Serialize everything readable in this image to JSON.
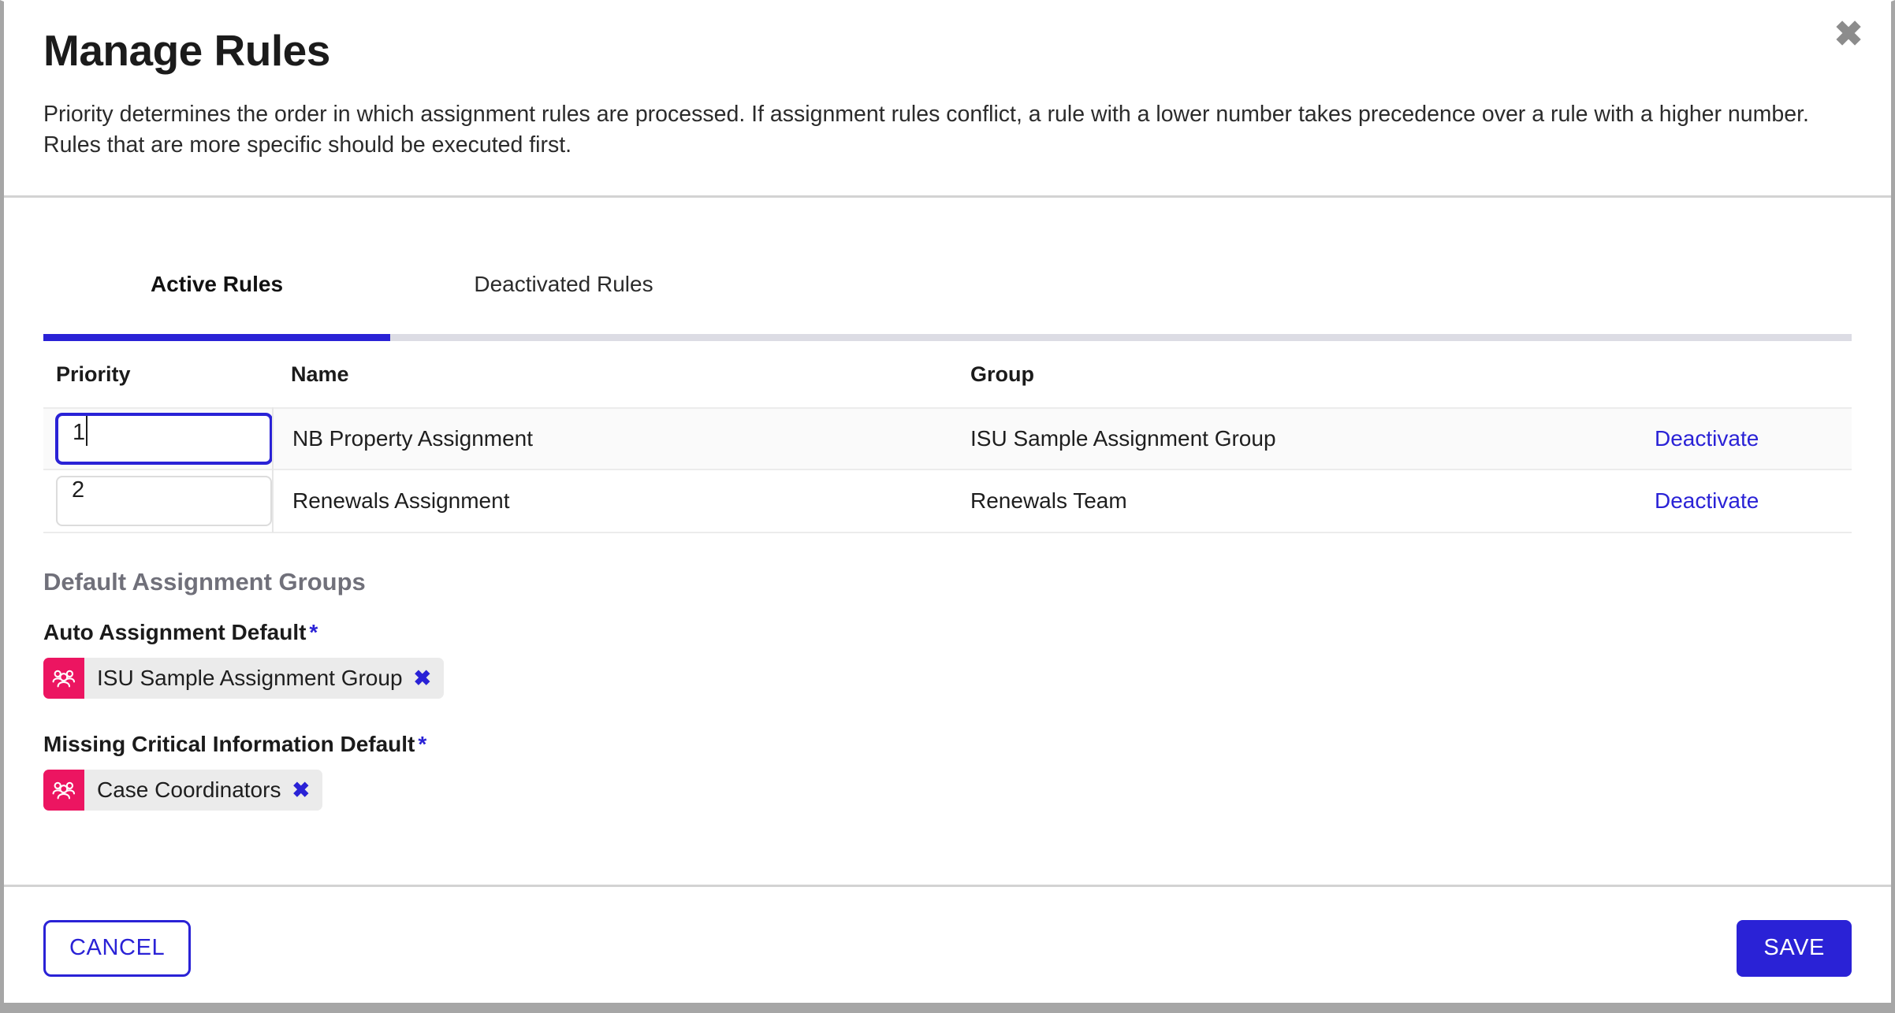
{
  "modal": {
    "title": "Manage Rules",
    "description": "Priority determines the order in which assignment rules are processed. If assignment rules conflict, a rule with a lower number takes precedence over a rule with a higher number. Rules that are more specific should be executed first.",
    "close_icon": "close-icon",
    "close_glyph": "✖"
  },
  "tabs": [
    {
      "label": "Active Rules",
      "active": true
    },
    {
      "label": "Deactivated Rules",
      "active": false
    }
  ],
  "table": {
    "headers": {
      "priority": "Priority",
      "name": "Name",
      "group": "Group",
      "action": ""
    },
    "rows": [
      {
        "priority": "1",
        "name": "NB Property Assignment",
        "group": "ISU Sample Assignment Group",
        "action": "Deactivate",
        "focused": true
      },
      {
        "priority": "2",
        "name": "Renewals Assignment",
        "group": "Renewals Team",
        "action": "Deactivate",
        "focused": false
      }
    ]
  },
  "defaults": {
    "section_title": "Default Assignment Groups",
    "fields": [
      {
        "label": "Auto Assignment Default",
        "required_marker": "*",
        "chip": {
          "icon": "user-group-icon",
          "label": "ISU Sample Assignment Group",
          "remove_glyph": "✖"
        }
      },
      {
        "label": "Missing Critical Information Default",
        "required_marker": "*",
        "chip": {
          "icon": "user-group-icon",
          "label": "Case Coordinators",
          "remove_glyph": "✖"
        }
      }
    ]
  },
  "footer": {
    "cancel_label": "CANCEL",
    "save_label": "SAVE"
  },
  "colors": {
    "accent": "#2a22d6",
    "chip_icon": "#ec1561",
    "tab_rail": "#dcdce4",
    "row_stripe": "#fafafa",
    "close": "#8c8c8c"
  }
}
